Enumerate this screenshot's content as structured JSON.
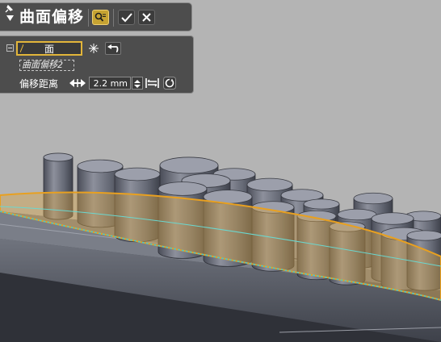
{
  "dialog": {
    "title": "曲面偏移",
    "toolbar": {
      "preview_icon": "preview-search-icon",
      "ok_icon": "checkmark-icon",
      "cancel_icon": "close-icon"
    }
  },
  "options": {
    "face_selector_label": "面",
    "selected_item": "曲面偏移2",
    "distance_label": "偏移距离",
    "distance_value": "2.2 mm",
    "icons": [
      "minus-box-icon",
      "asterisk-icon",
      "undo-icon",
      "flip-direction-icon",
      "spinner-icon",
      "measure-icon",
      "reset-icon"
    ]
  },
  "colors": {
    "panel": "#4d4d4d",
    "accent": "#e2b53a",
    "background": "#b4b4b4",
    "surface_highlight": "#4ec8c8"
  }
}
